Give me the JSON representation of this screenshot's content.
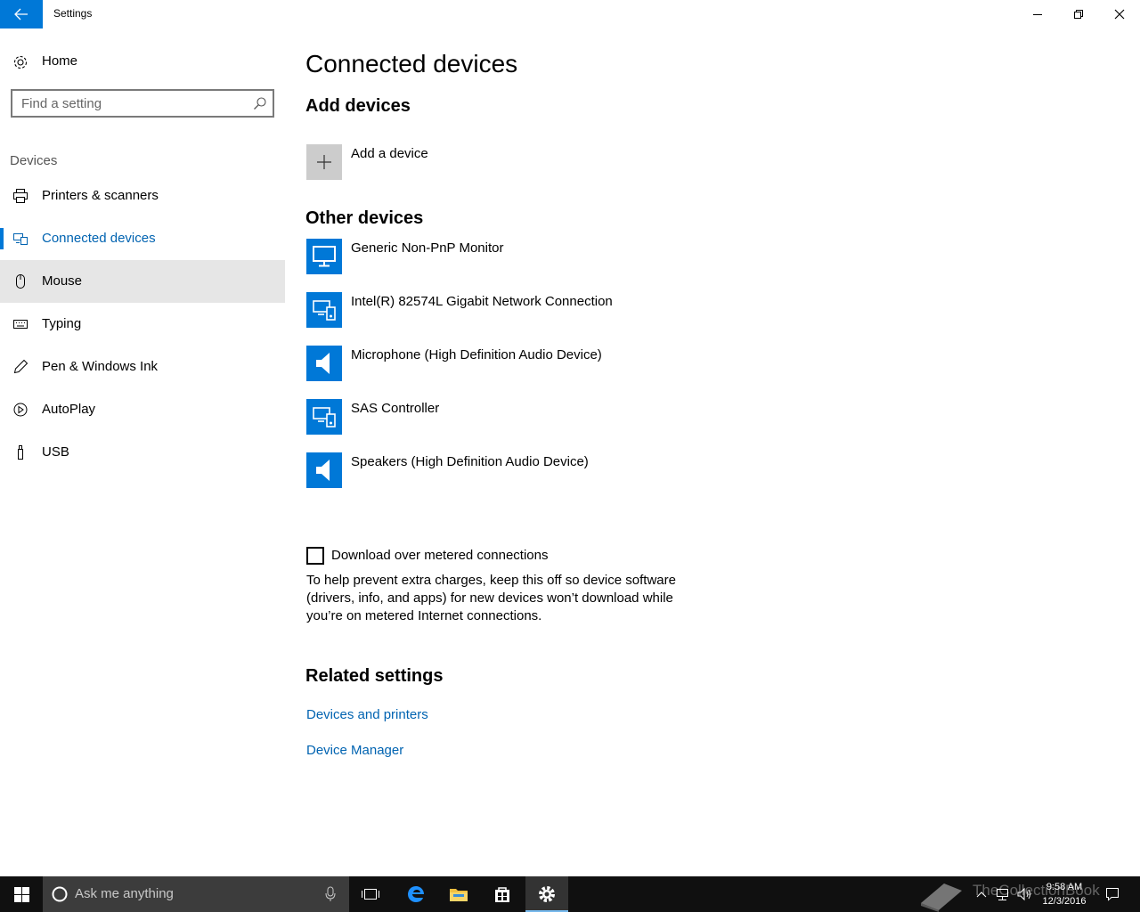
{
  "window": {
    "title": "Settings"
  },
  "sidebar": {
    "home_label": "Home",
    "search_placeholder": "Find a setting",
    "section_label": "Devices",
    "items": [
      {
        "label": "Printers & scanners",
        "icon": "printer-icon"
      },
      {
        "label": "Connected devices",
        "icon": "connected-devices-icon",
        "state": "selected"
      },
      {
        "label": "Mouse",
        "icon": "mouse-icon",
        "state": "hover"
      },
      {
        "label": "Typing",
        "icon": "keyboard-icon"
      },
      {
        "label": "Pen & Windows Ink",
        "icon": "pen-icon"
      },
      {
        "label": "AutoPlay",
        "icon": "autoplay-icon"
      },
      {
        "label": "USB",
        "icon": "usb-icon"
      }
    ]
  },
  "main": {
    "title": "Connected devices",
    "add_section": {
      "heading": "Add devices",
      "add_label": "Add a device"
    },
    "other_section": {
      "heading": "Other devices",
      "devices": [
        {
          "label": "Generic Non-PnP Monitor",
          "icon": "monitor-icon"
        },
        {
          "label": "Intel(R) 82574L Gigabit Network Connection",
          "icon": "generic-device-icon"
        },
        {
          "label": "Microphone (High Definition Audio Device)",
          "icon": "speaker-icon"
        },
        {
          "label": "SAS Controller",
          "icon": "generic-device-icon"
        },
        {
          "label": "Speakers (High Definition Audio Device)",
          "icon": "speaker-icon"
        }
      ]
    },
    "metered": {
      "checkbox_label": "Download over metered connections",
      "checked": false,
      "description": "To help prevent extra charges, keep this off so device software (drivers, info, and apps) for new devices won’t download while you’re on metered Internet connections."
    },
    "related": {
      "heading": "Related settings",
      "links": [
        "Devices and printers",
        "Device Manager"
      ]
    }
  },
  "taskbar": {
    "search_placeholder": "Ask me anything",
    "clock_time": "9:58 AM",
    "clock_date": "12/3/2016",
    "watermark": "TheCollectionBook"
  },
  "colors": {
    "accent": "#0078d7",
    "link": "#0063b1",
    "hover": "#e6e6e6",
    "taskbar": "#101010"
  }
}
